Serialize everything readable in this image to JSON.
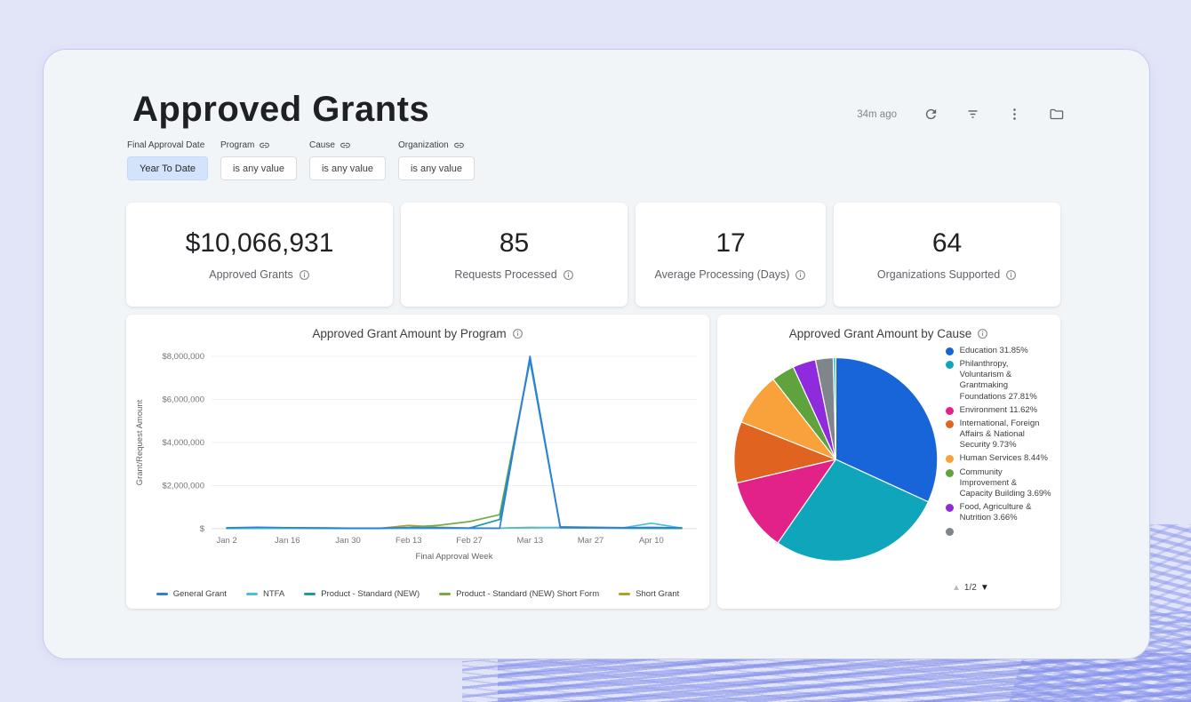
{
  "header": {
    "title": "Approved Grants",
    "updated": "34m ago"
  },
  "toolbar": {
    "icons": [
      "refresh-icon",
      "filter-icon",
      "kebab-menu-icon",
      "folder-icon"
    ]
  },
  "filters": [
    {
      "label": "Final Approval Date",
      "value": "Year To Date",
      "active": true,
      "linked": false
    },
    {
      "label": "Program",
      "value": "is any value",
      "active": false,
      "linked": true
    },
    {
      "label": "Cause",
      "value": "is any value",
      "active": false,
      "linked": true
    },
    {
      "label": "Organization",
      "value": "is any value",
      "active": false,
      "linked": true
    }
  ],
  "kpis": [
    {
      "value": "$10,066,931",
      "label": "Approved Grants"
    },
    {
      "value": "85",
      "label": "Requests Processed"
    },
    {
      "value": "17",
      "label": "Average Processing (Days)"
    },
    {
      "value": "64",
      "label": "Organizations Supported"
    }
  ],
  "chart_data": [
    {
      "type": "line",
      "title": "Approved Grant Amount by Program",
      "xlabel": "Final Approval Week",
      "ylabel": "Grant/Request Amount",
      "ylim": [
        0,
        8000000
      ],
      "grid": true,
      "legend_position": "bottom",
      "yticks": [
        {
          "v": 0,
          "label": "$"
        },
        {
          "v": 2000000,
          "label": "$2,000,000"
        },
        {
          "v": 4000000,
          "label": "$4,000,000"
        },
        {
          "v": 6000000,
          "label": "$6,000,000"
        },
        {
          "v": 8000000,
          "label": "$8,000,000"
        }
      ],
      "x": [
        "Jan 2",
        "Jan 9",
        "Jan 16",
        "Jan 23",
        "Jan 30",
        "Feb 6",
        "Feb 13",
        "Feb 20",
        "Feb 27",
        "Mar 6",
        "Mar 13",
        "Mar 20",
        "Mar 27",
        "Apr 3",
        "Apr 10",
        "Apr 17"
      ],
      "xtick_every": 2,
      "series": [
        {
          "name": "General Grant",
          "color": "#2E7DE0",
          "values": [
            40000,
            70000,
            50000,
            40000,
            30000,
            30000,
            50000,
            40000,
            30000,
            20000,
            8000000,
            70000,
            50000,
            40000,
            60000,
            40000
          ]
        },
        {
          "name": "NTFA",
          "color": "#4BC0DC",
          "values": [
            15000,
            25000,
            20000,
            15000,
            10000,
            10000,
            25000,
            20000,
            15000,
            30000,
            40000,
            60000,
            45000,
            30000,
            255000,
            35000
          ]
        },
        {
          "name": "Product - Standard (NEW)",
          "color": "#1F99A3",
          "values": [
            10000,
            15000,
            12000,
            10000,
            8000,
            8000,
            15000,
            12000,
            30000,
            430000,
            7800000,
            40000,
            35000,
            25000,
            20000,
            12000
          ]
        },
        {
          "name": "Product - Standard (NEW) Short Form",
          "color": "#74AC44",
          "values": [
            25000,
            45000,
            35000,
            25000,
            20000,
            20000,
            70000,
            160000,
            330000,
            650000,
            7850000,
            90000,
            75000,
            55000,
            45000,
            30000
          ]
        },
        {
          "name": "Short Grant",
          "color": "#B3A02C",
          "values": [
            12000,
            30000,
            22000,
            16000,
            12000,
            12000,
            155000,
            70000,
            35000,
            25000,
            60000,
            45000,
            65000,
            35000,
            25000,
            18000
          ]
        }
      ]
    },
    {
      "type": "pie",
      "title": "Approved Grant Amount by Cause",
      "legend_position": "right",
      "pagination": {
        "page": "1/2",
        "up_enabled": false,
        "down_enabled": true
      },
      "slices": [
        {
          "label": "Education",
          "pct": 31.85,
          "color": "#1765D8"
        },
        {
          "label": "Philanthropy, Voluntarism & Grantmaking Foundations",
          "pct": 27.81,
          "color": "#0FA6BC"
        },
        {
          "label": "Environment",
          "pct": 11.62,
          "color": "#E32289"
        },
        {
          "label": "International, Foreign Affairs & National Security",
          "pct": 9.73,
          "color": "#E0641F"
        },
        {
          "label": "Human Services",
          "pct": 8.44,
          "color": "#F9A13B"
        },
        {
          "label": "Community Improvement & Capacity Building",
          "pct": 3.69,
          "color": "#5FA33E"
        },
        {
          "label": "Food, Agriculture & Nutrition",
          "pct": 3.66,
          "color": "#8F2BDD"
        },
        {
          "label": "",
          "pct": 2.8,
          "color": "#7F858A"
        },
        {
          "label": "",
          "pct": 0.4,
          "color": "#2FBFC7"
        }
      ]
    }
  ]
}
